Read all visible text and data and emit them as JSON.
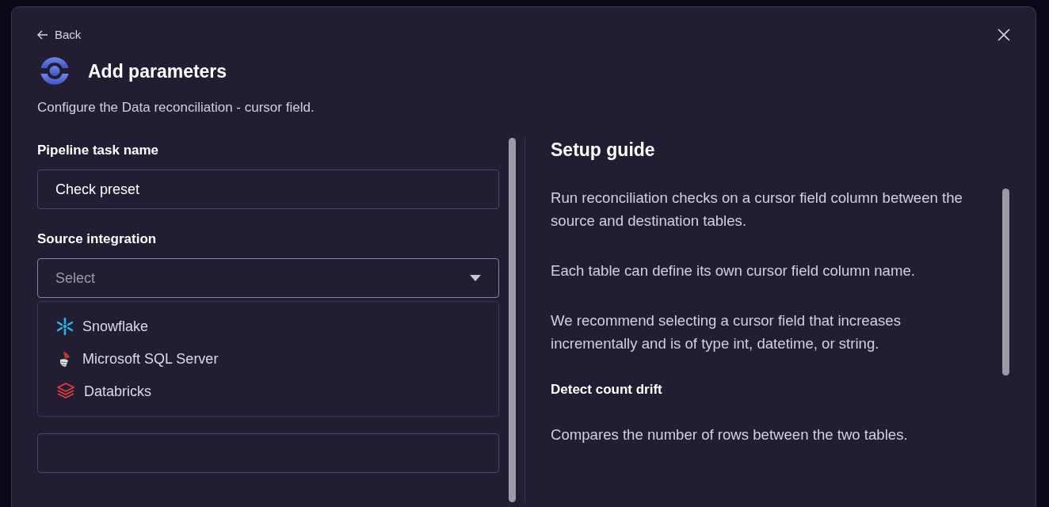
{
  "dialog": {
    "back": "Back",
    "title": "Add parameters",
    "subtitle": "Configure the Data reconciliation - cursor field."
  },
  "form": {
    "task_name": {
      "label": "Pipeline task name",
      "value": "Check preset"
    },
    "source_integration": {
      "label": "Source integration",
      "placeholder": "Select",
      "expanded": true,
      "options": [
        {
          "kind": "snowflake",
          "label": "Snowflake"
        },
        {
          "kind": "sqlserver",
          "label": "Microsoft SQL Server"
        },
        {
          "kind": "databricks",
          "label": "Databricks"
        }
      ]
    }
  },
  "guide": {
    "title": "Setup guide",
    "blocks": [
      {
        "kind": "paragraph",
        "text": "Run reconciliation checks on a cursor field column between the source and destination tables."
      },
      {
        "kind": "paragraph",
        "text": "Each table can define its own cursor field column name."
      },
      {
        "kind": "paragraph",
        "text": "We recommend selecting a cursor field that increases incrementally and is of type int, datetime, or string."
      },
      {
        "kind": "heading",
        "text": "Detect count drift"
      },
      {
        "kind": "paragraph",
        "text": "Compares the number of rows between the two tables."
      }
    ]
  }
}
